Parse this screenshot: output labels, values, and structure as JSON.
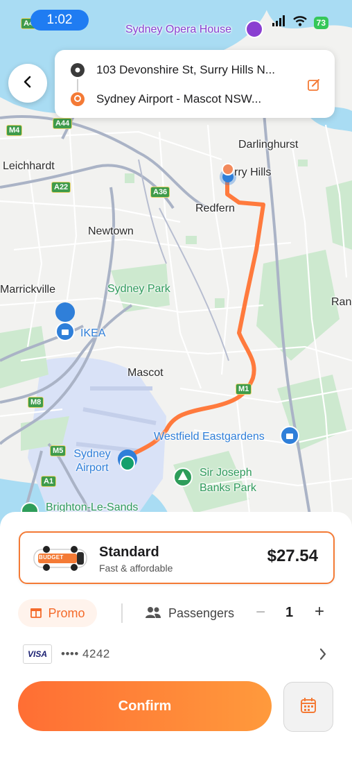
{
  "status_bar": {
    "time": "1:02",
    "battery": "73"
  },
  "route": {
    "origin": "103 Devonshire St, Surry Hills N...",
    "destination": "Sydney Airport - Mascot NSW..."
  },
  "map": {
    "places": [
      "Sydney Opera House",
      "Darlinghurst",
      "rry Hills",
      "Leichhardt",
      "Redfern",
      "Newtown",
      "Marrickville",
      "Sydney Park",
      "IKEA",
      "Ran",
      "Mascot",
      "Westfield Eastgardens",
      "Sydney Airport",
      "Sir Joseph Banks Park",
      "Brighton-Le-Sands"
    ],
    "road_shields": [
      "A4",
      "M4",
      "A44",
      "A22",
      "A36",
      "M8",
      "M1",
      "M5",
      "A1"
    ]
  },
  "ride_option": {
    "name": "Standard",
    "subtitle": "Fast & affordable",
    "price": "$27.54",
    "car_decal": "BUDGET"
  },
  "controls": {
    "promo_label": "Promo",
    "passengers_label": "Passengers",
    "passengers_count": "1",
    "decrement": "−",
    "increment": "+"
  },
  "payment": {
    "card_brand": "VISA",
    "card_number": "•••• 4242"
  },
  "confirm_label": "Confirm",
  "colors": {
    "accent": "#f47a35",
    "route_line": "#ff7a3d",
    "status_blue": "#1f7cf2"
  }
}
